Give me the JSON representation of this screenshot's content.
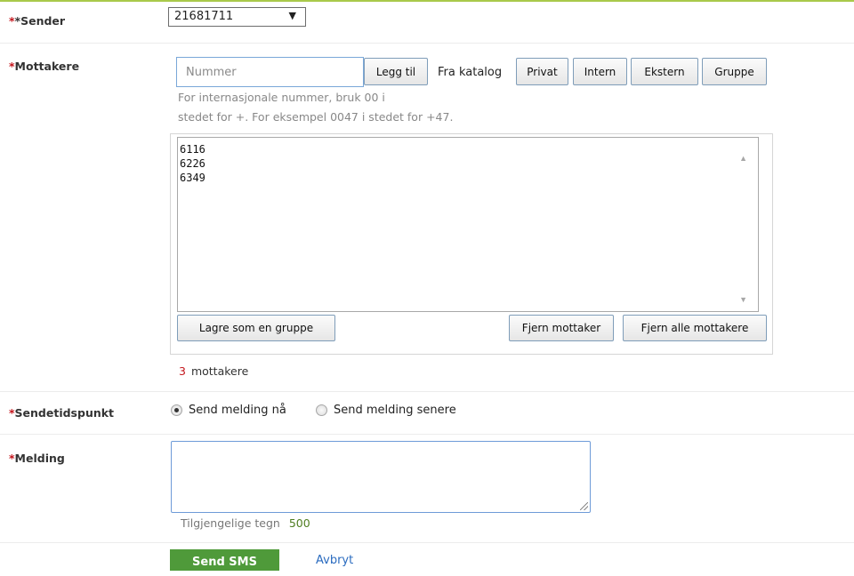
{
  "sender": {
    "label": "*Sender",
    "star": "*",
    "selected": "21681711",
    "arrow": "▼"
  },
  "recipients": {
    "label": "Mottakere",
    "star": "*",
    "number_placeholder": "Nummer",
    "add_button": "Legg til",
    "catalog_label": "Fra katalog",
    "catalog_buttons": [
      "Privat",
      "Intern",
      "Ekstern",
      "Gruppe"
    ],
    "hint_line1": "For internasjonale nummer, bruk 00 i",
    "hint_line2": "stedet for +. For eksempel 0047 i stedet for +47.",
    "list": [
      "6116",
      "6226",
      "6349"
    ],
    "save_group_button": "Lagre som en gruppe",
    "remove_button": "Fjern mottaker",
    "remove_all_button": "Fjern alle mottakere",
    "count": "3",
    "count_label": "mottakere"
  },
  "send_time": {
    "label": "Sendetidspunkt",
    "star": "*",
    "option_now": "Send melding nå",
    "option_later": "Send melding senere",
    "selected": "now"
  },
  "message": {
    "label": "Melding",
    "star": "*",
    "available_label": "Tilgjengelige tegn",
    "available_count": "500"
  },
  "actions": {
    "send": "Send SMS",
    "cancel": "Avbryt"
  },
  "colors": {
    "accent_line": "#a9c94b",
    "required": "#c4151c",
    "send_button": "#4f9a3a",
    "link": "#2a6bbf"
  }
}
